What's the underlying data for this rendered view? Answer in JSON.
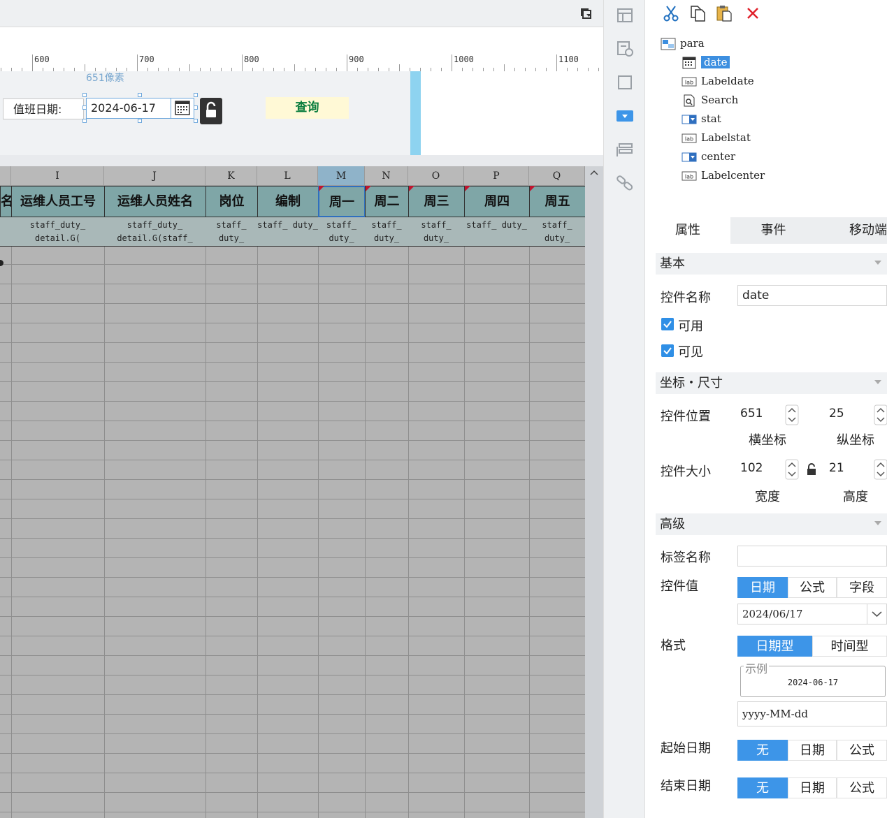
{
  "ruler": {
    "labels": [
      "600",
      "700",
      "800",
      "900",
      "1000",
      "1100"
    ]
  },
  "param": {
    "label_date": "值班日期:",
    "pixel_hint": "651像素",
    "date_value": "2024-06-17",
    "search_label": "查询"
  },
  "grid": {
    "columns": [
      {
        "letter": "",
        "header": "名",
        "field": ""
      },
      {
        "letter": "I",
        "header": "运维人员工号",
        "field": "staff_duty_ detail.G("
      },
      {
        "letter": "J",
        "header": "运维人员姓名",
        "field": "staff_duty_ detail.G(staff_"
      },
      {
        "letter": "K",
        "header": "岗位",
        "field": "staff_ duty_"
      },
      {
        "letter": "L",
        "header": "编制",
        "field": "staff_ duty_"
      },
      {
        "letter": "M",
        "header": "周一",
        "field": "staff_ duty_"
      },
      {
        "letter": "N",
        "header": "周二",
        "field": "staff_ duty_"
      },
      {
        "letter": "O",
        "header": "周三",
        "field": "staff_ duty_"
      },
      {
        "letter": "P",
        "header": "周四",
        "field": "staff_ duty_"
      },
      {
        "letter": "Q",
        "header": "周五",
        "field": "staff_ duty_"
      }
    ]
  },
  "tree": {
    "root": "para",
    "items": [
      {
        "name": "date",
        "icon": "calendar-icon"
      },
      {
        "name": "Labeldate",
        "icon": "label-icon"
      },
      {
        "name": "Search",
        "icon": "search-doc-icon"
      },
      {
        "name": "stat",
        "icon": "dropdown-icon"
      },
      {
        "name": "Labelstat",
        "icon": "label-icon"
      },
      {
        "name": "center",
        "icon": "dropdown-icon"
      },
      {
        "name": "Labelcenter",
        "icon": "label-icon"
      }
    ]
  },
  "tabs": [
    "属性",
    "事件",
    "移动端"
  ],
  "props": {
    "section_basic": "基本",
    "widget_name_label": "控件名称",
    "widget_name_value": "date",
    "enabled_label": "可用",
    "visible_label": "可见",
    "section_geometry": "坐标・尺寸",
    "position_label": "控件位置",
    "x_value": "651",
    "y_value": "25",
    "x_caption": "横坐标",
    "y_caption": "纵坐标",
    "size_label": "控件大小",
    "width_value": "102",
    "height_value": "21",
    "width_caption": "宽度",
    "height_caption": "高度",
    "section_advanced": "高级",
    "tag_name_label": "标签名称",
    "tag_name_value": "",
    "widget_value_label": "控件值",
    "value_modes": [
      "日期",
      "公式",
      "字段"
    ],
    "value_date": "2024/06/17",
    "format_label": "格式",
    "format_modes": [
      "日期型",
      "时间型"
    ],
    "example_caption": "示例",
    "example_value": "2024-06-17",
    "format_pattern": "yyyy-MM-dd",
    "start_date_label": "起始日期",
    "end_date_label": "结束日期",
    "range_modes": [
      "无",
      "日期",
      "公式"
    ]
  },
  "colors": {
    "accent": "#3d95e8",
    "header_cell": "#7fa6a7",
    "search_text": "#0a7d3e"
  }
}
